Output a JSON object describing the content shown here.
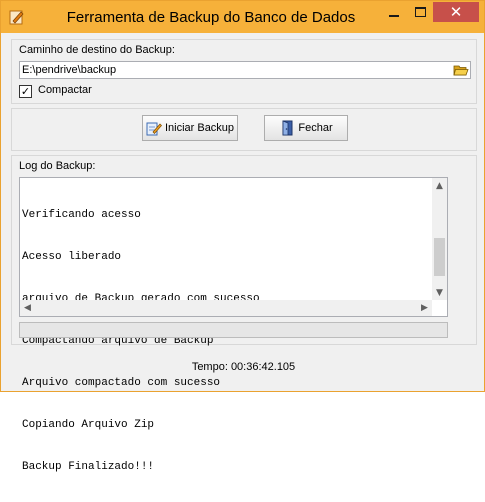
{
  "window": {
    "title": "Ferramenta de Backup do Banco de Dados",
    "accent_color": "#f6b13a",
    "close_color": "#c7504a",
    "controls": {
      "minimize_icon": "minimize-icon",
      "maximize_icon": "maximize-icon",
      "close_icon": "close-icon",
      "close_glyph": "✕"
    }
  },
  "destination": {
    "label": "Caminho de destino do Backup:",
    "path_value": "E:\\pendrive\\backup",
    "browse_icon": "folder-open-icon"
  },
  "compress": {
    "label": "Compactar",
    "checked": true,
    "check_glyph": "✓"
  },
  "actions": {
    "start_label": "Iniciar Backup",
    "start_icon": "backup-edit-icon",
    "close_label": "Fechar",
    "close_icon": "exit-door-icon"
  },
  "log": {
    "label": "Log do Backup:",
    "lines": [
      "Verificando acesso",
      "Acesso liberado",
      "arquivo de Backup gerado com sucesso",
      "Compactando arquivo de Backup",
      "Arquivo compactado com sucesso",
      "Copiando Arquivo Zip",
      "Backup Finalizado!!!"
    ]
  },
  "progress": {
    "value": 0
  },
  "timer": {
    "text": "Tempo: 00:36:42.105"
  }
}
